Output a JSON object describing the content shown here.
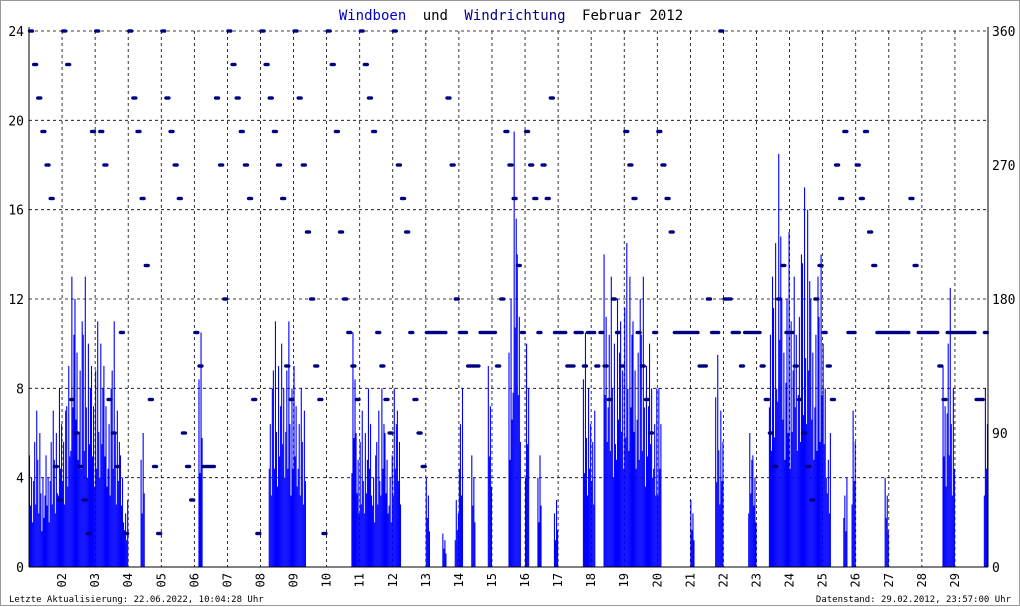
{
  "chart_data": {
    "type": "bar",
    "title_parts": [
      {
        "text": "Windboen",
        "color": "#0000cc"
      },
      {
        "text": "und",
        "color": "#000000"
      },
      {
        "text": "Windrichtung",
        "color": "#000080"
      },
      {
        "text": "Februar 2012",
        "color": "#000000"
      }
    ],
    "x_tick_labels": [
      "02",
      "03",
      "04",
      "05",
      "06",
      "07",
      "08",
      "09",
      "10",
      "11",
      "12",
      "13",
      "14",
      "15",
      "16",
      "17",
      "18",
      "19",
      "20",
      "21",
      "22",
      "23",
      "24",
      "25",
      "26",
      "27",
      "28",
      "29"
    ],
    "days": 29,
    "samples_per_day": 8,
    "left_axis": {
      "label": "Windboen",
      "ylim": [
        0,
        24
      ],
      "ticks": [
        "0",
        "4",
        "8",
        "12",
        "16",
        "20",
        "24"
      ]
    },
    "right_axis": {
      "label": "Windrichtung",
      "ylim": [
        0,
        360
      ],
      "ticks": [
        "0",
        "90",
        "180",
        "270",
        "360"
      ]
    },
    "series": [
      {
        "name": "Windboen",
        "type": "bar",
        "color": "#0000ff",
        "values": [
          [
            5,
            7,
            6,
            4,
            5,
            7,
            6,
            8
          ],
          [
            7,
            9,
            13,
            12,
            11,
            13,
            10,
            9
          ],
          [
            11,
            10,
            9,
            8,
            11,
            7,
            5,
            3
          ],
          [
            0,
            0,
            0,
            6,
            0,
            0,
            0,
            0
          ],
          [
            0,
            0,
            0,
            0,
            0,
            0,
            0,
            0
          ],
          [
            0,
            10.5,
            0,
            0,
            0,
            0,
            0,
            0
          ],
          [
            0,
            0,
            0,
            0,
            0,
            0,
            0,
            0
          ],
          [
            0,
            0,
            8,
            11,
            9,
            10,
            11,
            8
          ],
          [
            9,
            8,
            7,
            0,
            0,
            0,
            0,
            0
          ],
          [
            0,
            0,
            0,
            0,
            0,
            0,
            10.5,
            6
          ],
          [
            7,
            6,
            8,
            5,
            7,
            8,
            6,
            5
          ],
          [
            8,
            7,
            0,
            0,
            0,
            0,
            0,
            0
          ],
          [
            4,
            0,
            0,
            0,
            1.5,
            0,
            0,
            3
          ],
          [
            8,
            0,
            0,
            5,
            0,
            0,
            0,
            9
          ],
          [
            0,
            0,
            0,
            0,
            12,
            19.5,
            14,
            0
          ],
          [
            10,
            0,
            0,
            5,
            0,
            0,
            0,
            3
          ],
          [
            0,
            0,
            0,
            0,
            0,
            0,
            10.5,
            8
          ],
          [
            7,
            0,
            0,
            14,
            13,
            10,
            12,
            11
          ],
          [
            14.5,
            13,
            11,
            12,
            13,
            9,
            10,
            8
          ],
          [
            8,
            0,
            0,
            0,
            0,
            0,
            0,
            0
          ],
          [
            3,
            0,
            0,
            0,
            0,
            0,
            9.5,
            7
          ],
          [
            0,
            0,
            0,
            0,
            0,
            0,
            6,
            5
          ],
          [
            0,
            0,
            0,
            13,
            14.5,
            18.5,
            12,
            15
          ],
          [
            11,
            13,
            14,
            17,
            16,
            12,
            13,
            14
          ],
          [
            10,
            6,
            0,
            0,
            0,
            4,
            0,
            7
          ],
          [
            0,
            0,
            0,
            0,
            0,
            0,
            0,
            4
          ],
          [
            0,
            0,
            0,
            0,
            0,
            0,
            0,
            0
          ],
          [
            0,
            0,
            0,
            0,
            0,
            9,
            12.5,
            8
          ],
          [
            0,
            0,
            0,
            0,
            0,
            0,
            0,
            8
          ]
        ]
      },
      {
        "name": "Windrichtung",
        "type": "scatter",
        "color": "#000080",
        "values": [
          [
            360,
            337.5,
            315,
            292.5,
            270,
            247.5,
            67.5,
            45
          ],
          [
            360,
            337.5,
            112.5,
            90,
            67.5,
            45,
            22.5,
            292.5
          ],
          [
            360,
            292.5,
            270,
            112.5,
            90,
            67.5,
            157.5,
            22.5
          ],
          [
            360,
            315,
            292.5,
            247.5,
            202.5,
            112.5,
            67.5,
            22.5
          ],
          [
            360,
            315,
            292.5,
            270,
            247.5,
            90,
            67.5,
            45
          ],
          [
            157.5,
            135,
            67.5,
            67.5,
            67.5,
            315,
            270,
            180
          ],
          [
            360,
            337.5,
            315,
            292.5,
            270,
            247.5,
            112.5,
            22.5
          ],
          [
            360,
            337.5,
            315,
            292.5,
            270,
            247.5,
            135,
            112.5
          ],
          [
            360,
            315,
            270,
            225,
            180,
            135,
            112.5,
            22.5
          ],
          [
            360,
            337.5,
            292.5,
            225,
            180,
            157.5,
            135,
            112.5
          ],
          [
            360,
            337.5,
            315,
            292.5,
            157.5,
            135,
            112.5,
            90
          ],
          [
            360,
            270,
            247.5,
            225,
            157.5,
            112.5,
            90,
            67.5
          ],
          [
            157.5,
            157.5,
            157.5,
            157.5,
            157.5,
            315,
            270,
            180
          ],
          [
            157.5,
            157.5,
            135,
            135,
            135,
            157.5,
            157.5,
            157.5
          ],
          [
            157.5,
            135,
            180,
            292.5,
            270,
            247.5,
            202.5,
            157.5
          ],
          [
            292.5,
            270,
            247.5,
            157.5,
            270,
            247.5,
            315,
            157.5
          ],
          [
            157.5,
            157.5,
            135,
            135,
            157.5,
            157.5,
            135,
            157.5
          ],
          [
            157.5,
            135,
            157.5,
            135,
            112.5,
            180,
            157.5,
            135
          ],
          [
            292.5,
            270,
            247.5,
            157.5,
            135,
            112.5,
            90,
            157.5
          ],
          [
            292.5,
            270,
            247.5,
            225,
            157.5,
            157.5,
            157.5,
            157.5
          ],
          [
            157.5,
            157.5,
            135,
            135,
            180,
            157.5,
            157.5,
            360
          ],
          [
            180,
            180,
            157.5,
            157.5,
            135,
            157.5,
            157.5,
            157.5
          ],
          [
            157.5,
            135,
            112.5,
            90,
            67.5,
            180,
            202.5,
            157.5
          ],
          [
            157.5,
            135,
            112.5,
            90,
            67.5,
            45,
            180,
            202.5
          ],
          [
            157.5,
            135,
            112.5,
            270,
            247.5,
            292.5,
            157.5,
            157.5
          ],
          [
            270,
            247.5,
            292.5,
            225,
            202.5,
            157.5,
            157.5,
            157.5
          ],
          [
            157.5,
            157.5,
            157.5,
            157.5,
            157.5,
            247.5,
            202.5,
            157.5
          ],
          [
            157.5,
            157.5,
            157.5,
            157.5,
            135,
            112.5,
            157.5,
            157.5
          ],
          [
            157.5,
            157.5,
            157.5,
            157.5,
            157.5,
            112.5,
            112.5,
            157.5
          ]
        ]
      }
    ],
    "grid": true
  },
  "footer": {
    "last_update": "Letzte Aktualisierung: 22.06.2022, 10:04:28 Uhr",
    "data_state": "Datenstand: 29.02.2012, 23:57:00 Uhr"
  }
}
